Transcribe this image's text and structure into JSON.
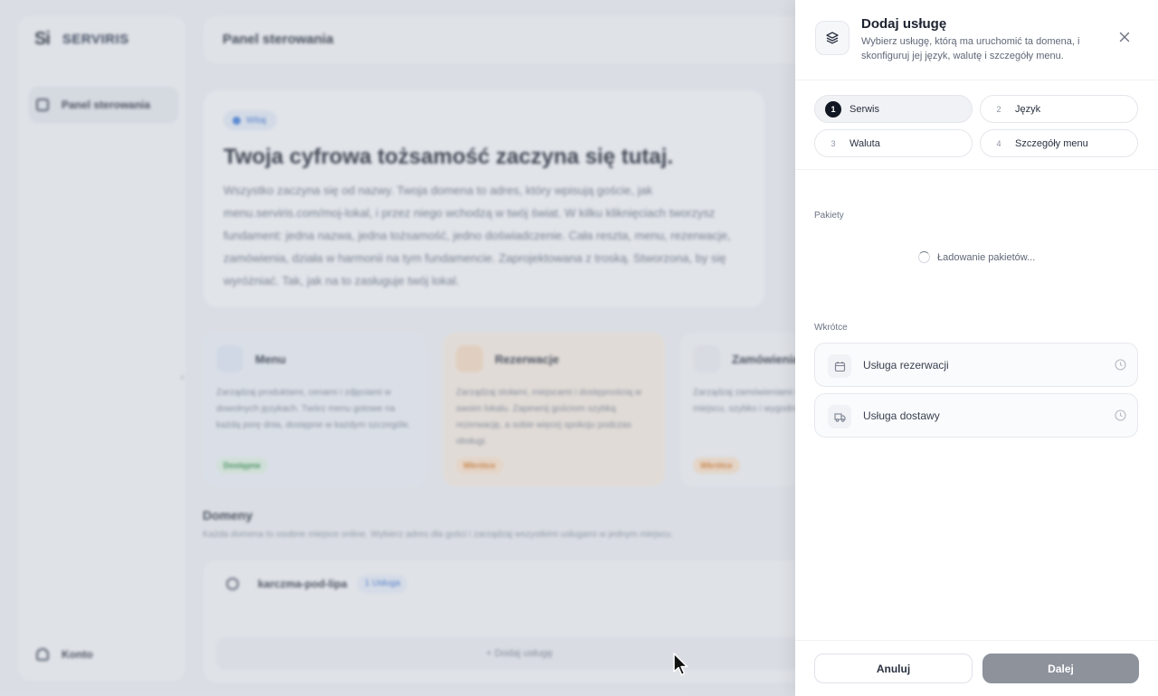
{
  "background": {
    "logo": {
      "mark": "Si",
      "text": "SERVIRIS"
    },
    "sidebar": {
      "items": [
        {
          "label": "Panel sterowania",
          "icon": "dashboard-icon"
        }
      ],
      "bottom_item": {
        "label": "Konto",
        "icon": "person-icon"
      }
    },
    "topbar": {
      "title": "Panel sterowania"
    },
    "hero": {
      "badge": "Witaj",
      "title": "Twoja cyfrowa tożsamość zaczyna się tutaj.",
      "text": "Wszystko zaczyna się od nazwy. Twoja domena to adres, który wpisują goście, jak menu.serviris.com/moj-lokal, i przez niego wchodzą w twój świat. W kilku kliknięciach tworzysz fundament: jedna nazwa, jedna tożsamość, jedno doświadczenie. Cała reszta, menu, rezerwacje, zamówienia, działa w harmonii na tym fundamencie. Zaprojektowana z troską. Stworzona, by się wyróżniać. Tak, jak na to zasługuje twój lokal."
    },
    "cards": [
      {
        "title": "Menu",
        "text": "Zarządzaj produktami, cenami i zdjęciami w dowolnych językach. Twórz menu gotowe na każdą porę dnia, dostępne w każdym szczególe.",
        "tag": "Dostępne"
      },
      {
        "title": "Rezerwacje",
        "text": "Zarządzaj stołami, miejscami i dostępnością w swoim lokalu. Zapewnij gościom szybką rezerwację, a sobie więcej spokoju podczas obsługi.",
        "tag": "Wkrótce"
      },
      {
        "title": "Zamówienia",
        "text": "Zarządzaj zamówieniami i dostawą w jednym miejscu, szybko i wygodnie, z pełną kontrolą.",
        "tag": "Wkrótce"
      }
    ],
    "domains": {
      "title": "Domeny",
      "subtitle": "Każda domena to osobne miejsce online. Wybierz adres dla gości i zarządzaj wszystkimi usługami w jednym miejscu.",
      "items": [
        {
          "name": "karczma-pod-lipa",
          "services": "1 Usługa"
        }
      ],
      "add_label": "+ Dodaj usługę"
    }
  },
  "dialog": {
    "title": "Dodaj usługę",
    "description": "Wybierz usługę, którą ma uruchomić ta domena, i skonfiguruj jej język, walutę i szczegóły menu.",
    "icon": "layers-icon",
    "steps": [
      {
        "num": "1",
        "label": "Serwis",
        "active": true
      },
      {
        "num": "2",
        "label": "Język",
        "active": false
      },
      {
        "num": "3",
        "label": "Waluta",
        "active": false
      },
      {
        "num": "4",
        "label": "Szczegóły menu",
        "active": false
      }
    ],
    "packages": {
      "label": "Pakiety",
      "loading_text": "Ładowanie pakietów..."
    },
    "coming_soon": {
      "label": "Wkrótce",
      "items": [
        {
          "label": "Usługa rezerwacji",
          "icon": "calendar-icon"
        },
        {
          "label": "Usługa dostawy",
          "icon": "truck-icon"
        }
      ]
    },
    "buttons": {
      "cancel": "Anuluj",
      "next": "Dalej"
    }
  }
}
